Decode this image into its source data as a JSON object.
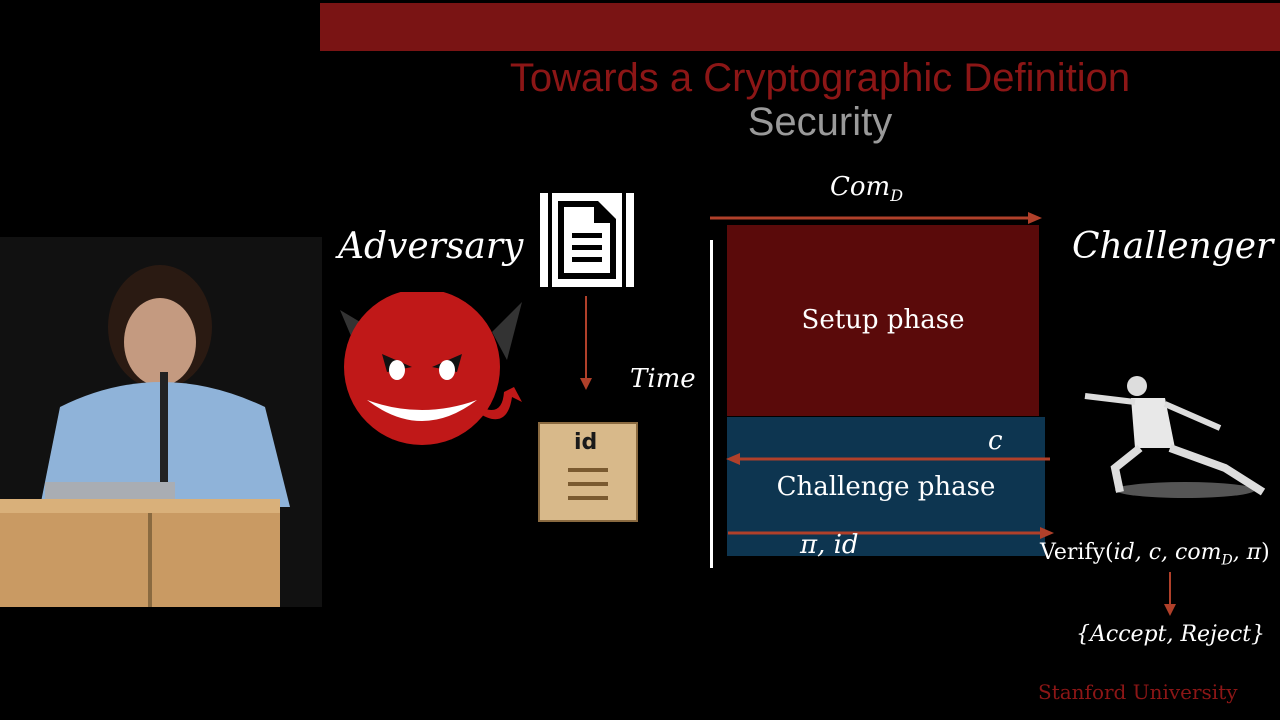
{
  "slide": {
    "title": "Towards a Cryptographic Definition",
    "subtitle": "Security"
  },
  "diagram": {
    "adversary_label": "Adversary",
    "challenger_label": "Challenger",
    "time_label": "Time",
    "commit_label": "Com_D",
    "setup_phase": "Setup phase",
    "challenge_label": "c",
    "challenge_phase": "Challenge phase",
    "response_label": "π, id",
    "verify_expr": "Verify(id, c, com_D, π)",
    "result_set": "{Accept, Reject}",
    "id_badge": "id"
  },
  "footer": {
    "institution": "Stanford University"
  },
  "colors": {
    "title_red": "#8c1616",
    "setup_fill": "#5a0a0a",
    "challenge_fill": "#0d3550",
    "arrow_red": "#b0402a"
  }
}
